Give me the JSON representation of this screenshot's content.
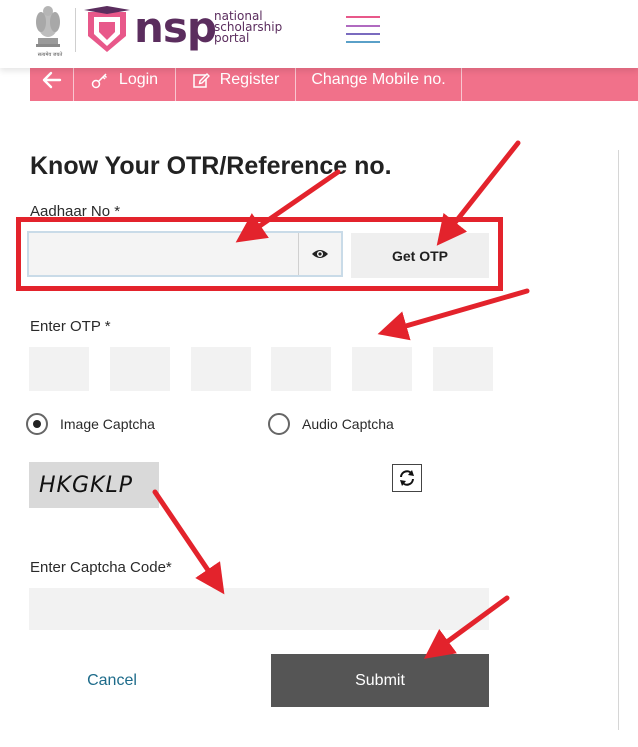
{
  "header": {
    "brand": "nsp",
    "tagline_lines": [
      "national",
      "scholarship",
      "portal"
    ],
    "emblem_caption": "सत्यमेव जयते",
    "menu_icon": "hamburger-menu-icon"
  },
  "nav": {
    "back_icon": "arrow-left-icon",
    "items": [
      {
        "label": "Login",
        "icon": "key-icon"
      },
      {
        "label": "Register",
        "icon": "edit-icon"
      },
      {
        "label": "Change Mobile no.",
        "icon": ""
      }
    ]
  },
  "form": {
    "title": "Know Your OTR/Reference no.",
    "aadhaar_label": "Aadhaar No *",
    "aadhaar_value": "",
    "show_icon": "eye-icon",
    "otp_button": "Get OTP",
    "otp_label": "Enter OTP *",
    "otp_digits": [
      "",
      "",
      "",
      "",
      "",
      ""
    ],
    "captcha_options": [
      {
        "label": "Image Captcha",
        "selected": true
      },
      {
        "label": "Audio Captcha",
        "selected": false
      }
    ],
    "captcha_text": "HKGKLP",
    "refresh_icon": "refresh-icon",
    "captcha_label": "Enter Captcha Code*",
    "captcha_value": "",
    "cancel_label": "Cancel",
    "submit_label": "Submit"
  },
  "colors": {
    "nav_bg": "#f1718a",
    "brand": "#5b2d5e",
    "annotation": "#e3232c",
    "submit_bg": "#555555",
    "cancel_text": "#1d6b8a"
  }
}
